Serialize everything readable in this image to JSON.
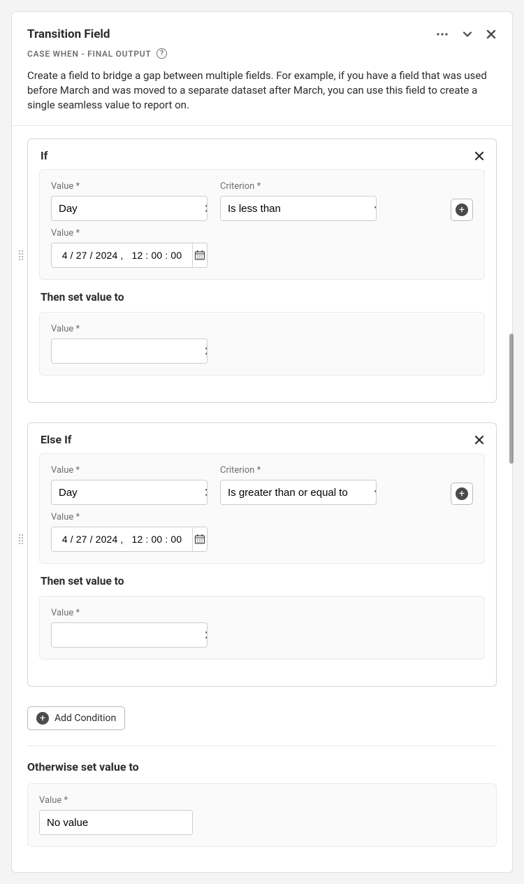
{
  "header": {
    "title": "Transition Field",
    "subtitle": "Case When - Final Output",
    "description": "Create a field to bridge a gap between multiple fields. For example, if you have a field that was used before March and was moved to a separate dataset after March, you can use this field to create a single seamless value to report on."
  },
  "labels": {
    "value": "Value",
    "criterion": "Criterion",
    "then": "Then set value to",
    "add_condition": "Add Condition",
    "otherwise": "Otherwise set value to"
  },
  "conditions": [
    {
      "title": "If",
      "field_value": "Day",
      "criterion": "Is less than",
      "date_value": "4 / 27 / 2024 ,   12 : 00 : 00",
      "then_value": ""
    },
    {
      "title": "Else If",
      "field_value": "Day",
      "criterion": "Is greater than or equal to",
      "date_value": "4 / 27 / 2024 ,   12 : 00 : 00",
      "then_value": ""
    }
  ],
  "otherwise": {
    "value": "No value"
  }
}
